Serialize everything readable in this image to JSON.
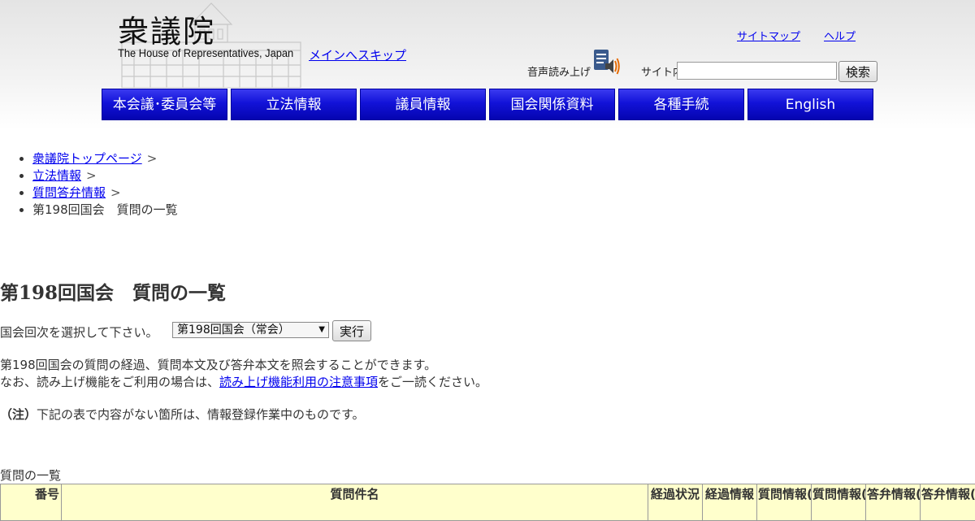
{
  "header": {
    "logo_jp": "衆議院",
    "logo_en": "The House of Representatives, Japan",
    "skip_link": "メインへスキップ",
    "sitemap": "サイトマップ",
    "help": "ヘルプ",
    "voice_label": "音声読み上げ",
    "search_label": "サイト内検索",
    "search_value": "",
    "search_button": "検索"
  },
  "nav": {
    "items": [
      {
        "label": "本会議･委員会等"
      },
      {
        "label": "立法情報"
      },
      {
        "label": "議員情報"
      },
      {
        "label": "国会関係資料"
      },
      {
        "label": "各種手続"
      },
      {
        "label": "English"
      }
    ]
  },
  "breadcrumb": {
    "items": [
      {
        "label": "衆議院トップページ",
        "sep": ">"
      },
      {
        "label": "立法情報",
        "sep": ">"
      },
      {
        "label": "質問答弁情報",
        "sep": ">"
      },
      {
        "label": "第198回国会　質問の一覧"
      }
    ]
  },
  "main": {
    "title": "第198回国会　質問の一覧",
    "session_label": "国会回次を選択して下さい。",
    "session_selected": "第198回国会（常会）",
    "exec_button": "実行",
    "desc_line1": "第198回国会の質問の経過、質問本文及び答弁本文を照会することができます。",
    "desc_line2_pre": "なお、読み上げ機能をご利用の場合は、",
    "desc_line2_link": "読み上げ機能利用の注意事項",
    "desc_line2_post": "をご一読ください。",
    "note_mark": "（注）",
    "note_text": "下記の表で内容がない箇所は、情報登録作業中のものです。",
    "table_caption": "質問の一覧"
  },
  "table": {
    "headers": [
      "番号",
      "質問件名",
      "経過状況",
      "経過情報",
      "質問情報(HTML)",
      "質問情報(PDF)",
      "答弁情報(HTML)",
      "答弁情報(PDF)"
    ]
  },
  "colors": {
    "nav_blue": "#1212d8",
    "link": "#0000ee",
    "table_header_bg": "#ffffcc"
  }
}
